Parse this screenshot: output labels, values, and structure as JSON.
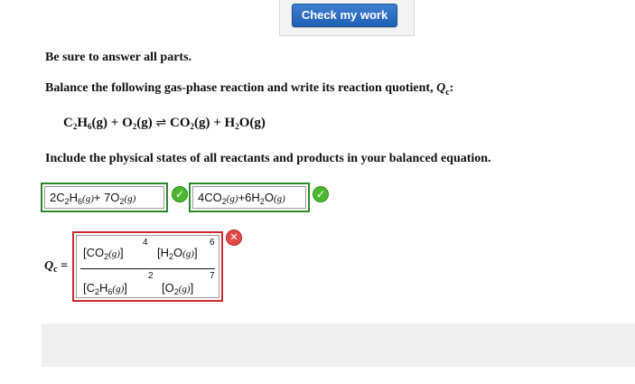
{
  "toolbar": {
    "check_label": "Check my work"
  },
  "heading": "Be sure to answer all parts.",
  "instruction": {
    "text": "Balance the following gas-phase reaction and write its reaction quotient, ",
    "q": "Q",
    "q_sub": "c",
    "colon": ":"
  },
  "reaction": {
    "r1": "C",
    "r1a": "2",
    "r1b": "H",
    "r1c": "6",
    "r1s": "(g)",
    "plus1": " + ",
    "r2": "O",
    "r2a": "2",
    "r2s": "(g)",
    "arrow": "⇌",
    "p1": "CO",
    "p1a": "2",
    "p1s": "(g)",
    "plus2": " + ",
    "p2": "H",
    "p2a": "2",
    "p2b": "O",
    "p2s": "(g)"
  },
  "include_text": "Include the physical states of all reactants and products in your balanced equation.",
  "reactants_answer": {
    "c1": "2C",
    "s1": "2",
    "c1b": "H",
    "s1b": "6",
    "st1": "(g)",
    "plus": "+ 7O",
    "s2": "2",
    "st2": "(g)"
  },
  "products_answer": {
    "c1": "4CO",
    "s1": "2",
    "st1": "(g)",
    "plus": "+6H",
    "s2": "2",
    "c2b": "O",
    "st2": "(g)"
  },
  "qc": {
    "label": "Q",
    "label_sub": "c",
    "eq": " =",
    "num_t1": "[CO",
    "num_t1_sub": "2",
    "num_t1_st": "(g)",
    "num_t1_close": "]",
    "num_t1_exp": "4",
    "num_t2": "[H",
    "num_t2_sub": "2",
    "num_t2_b": "O",
    "num_t2_st": "(g)",
    "num_t2_close": "]",
    "num_t2_exp": "6",
    "den_t1": "[C",
    "den_t1_sub": "2",
    "den_t1_b": "H",
    "den_t1_sub2": "6",
    "den_t1_st": "(g)",
    "den_t1_close": "]",
    "den_t1_exp": "2",
    "den_t2": "[O",
    "den_t2_sub": "2",
    "den_t2_st": "(g)",
    "den_t2_close": "]",
    "den_t2_exp": "7"
  },
  "status": {
    "correct_mark": "✓",
    "wrong_mark": "✕"
  }
}
